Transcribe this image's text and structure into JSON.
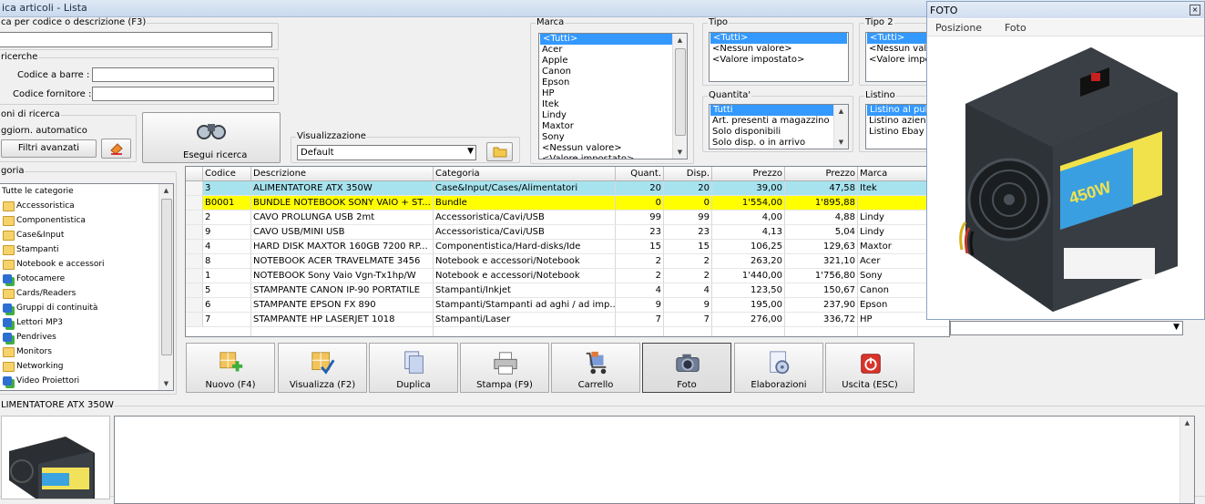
{
  "window": {
    "title": "ica articoli  - Lista"
  },
  "search": {
    "legend": "ca per codice o descrizione (F3)",
    "value": ""
  },
  "ricerche": {
    "legend": "ricerche",
    "barcode_label": "Codice a barre :",
    "supplier_label": "Codice fornitore :"
  },
  "opzioni": {
    "legend": "oni di ricerca",
    "auto_label": "ggiorn. automatico",
    "filters_button": "Filtri avanzati"
  },
  "esegui": {
    "label": "Esegui ricerca"
  },
  "visualizzazione": {
    "legend": "Visualizzazione",
    "value": "Default"
  },
  "marca": {
    "legend": "Marca",
    "items": [
      "<Tutti>",
      "Acer",
      "Apple",
      "Canon",
      "Epson",
      "HP",
      "Itek",
      "Lindy",
      "Maxtor",
      "Sony",
      "<Nessun valore>",
      "<Valore impostato>"
    ],
    "selected": "<Tutti>"
  },
  "tipo": {
    "legend": "Tipo",
    "items": [
      "<Tutti>",
      "<Nessun valore>",
      "<Valore impostato>"
    ],
    "selected": "<Tutti>"
  },
  "tipo2": {
    "legend": "Tipo 2",
    "items": [
      "<Tutti>",
      "<Nessun valor",
      "<Valore impost"
    ],
    "selected": "<Tutti>"
  },
  "quantita": {
    "legend": "Quantita'",
    "items": [
      "Tutti",
      "Art. presenti a magazzino",
      "Solo disponibili",
      "Solo disp. o in arrivo"
    ],
    "selected": "Tutti"
  },
  "listino": {
    "legend": "Listino",
    "items": [
      "Listino al pubb",
      "Listino aziende",
      "Listino Ebay"
    ],
    "selected": "Listino al pubb"
  },
  "categorie": {
    "legend": "goria",
    "items": [
      {
        "label": "Tutte le categorie",
        "icon": "none"
      },
      {
        "label": "Accessoristica",
        "icon": "folder-icon"
      },
      {
        "label": "Componentistica",
        "icon": "folder-icon"
      },
      {
        "label": "Case&Input",
        "icon": "folder-icon"
      },
      {
        "label": "Stampanti",
        "icon": "folder-icon"
      },
      {
        "label": "Notebook e accessori",
        "icon": "folder-icon"
      },
      {
        "label": "Fotocamere",
        "icon": "network-icon"
      },
      {
        "label": "Cards/Readers",
        "icon": "folder-icon"
      },
      {
        "label": "Gruppi di continuità",
        "icon": "network-icon"
      },
      {
        "label": "Lettori MP3",
        "icon": "network-icon"
      },
      {
        "label": "Pendrives",
        "icon": "network-icon"
      },
      {
        "label": "Monitors",
        "icon": "folder-icon"
      },
      {
        "label": "Networking",
        "icon": "folder-icon"
      },
      {
        "label": "Video Proiettori",
        "icon": "network-icon"
      }
    ]
  },
  "table": {
    "columns": [
      "Codice",
      "Descrizione",
      "Categoria",
      "Quant.",
      "Disp.",
      "Prezzo",
      "Prezzo",
      "Marca"
    ],
    "rows": [
      {
        "codice": "3",
        "descrizione": "ALIMENTATORE ATX 350W",
        "categoria": "Case&Input/Cases/Alimentatori",
        "quant": "20",
        "disp": "20",
        "prezzo1": "39,00",
        "prezzo2": "47,58",
        "marca": "Itek",
        "highlight": "#a6e3ef"
      },
      {
        "codice": "B0001",
        "descrizione": "BUNDLE NOTEBOOK SONY VAIO + ST...",
        "categoria": "Bundle",
        "quant": "0",
        "disp": "0",
        "prezzo1": "1'554,00",
        "prezzo2": "1'895,88",
        "marca": "",
        "highlight": "#ffff00"
      },
      {
        "codice": "2",
        "descrizione": "CAVO PROLUNGA USB 2mt",
        "categoria": "Accessoristica/Cavi/USB",
        "quant": "99",
        "disp": "99",
        "prezzo1": "4,00",
        "prezzo2": "4,88",
        "marca": "Lindy",
        "highlight": ""
      },
      {
        "codice": "9",
        "descrizione": "CAVO USB/MINI USB",
        "categoria": "Accessoristica/Cavi/USB",
        "quant": "23",
        "disp": "23",
        "prezzo1": "4,13",
        "prezzo2": "5,04",
        "marca": "Lindy",
        "highlight": ""
      },
      {
        "codice": "4",
        "descrizione": "HARD DISK MAXTOR 160GB 7200 RP...",
        "categoria": "Componentistica/Hard-disks/Ide",
        "quant": "15",
        "disp": "15",
        "prezzo1": "106,25",
        "prezzo2": "129,63",
        "marca": "Maxtor",
        "highlight": ""
      },
      {
        "codice": "8",
        "descrizione": "NOTEBOOK ACER TRAVELMATE 3456",
        "categoria": "Notebook e accessori/Notebook",
        "quant": "2",
        "disp": "2",
        "prezzo1": "263,20",
        "prezzo2": "321,10",
        "marca": "Acer",
        "highlight": ""
      },
      {
        "codice": "1",
        "descrizione": "NOTEBOOK Sony Vaio Vgn-Tx1hp/W",
        "categoria": "Notebook e accessori/Notebook",
        "quant": "2",
        "disp": "2",
        "prezzo1": "1'440,00",
        "prezzo2": "1'756,80",
        "marca": "Sony",
        "highlight": ""
      },
      {
        "codice": "5",
        "descrizione": "STAMPANTE CANON IP-90 PORTATILE",
        "categoria": "Stampanti/Inkjet",
        "quant": "4",
        "disp": "4",
        "prezzo1": "123,50",
        "prezzo2": "150,67",
        "marca": "Canon",
        "highlight": ""
      },
      {
        "codice": "6",
        "descrizione": "STAMPANTE EPSON FX 890",
        "categoria": "Stampanti/Stampanti ad aghi / ad imp...",
        "quant": "9",
        "disp": "9",
        "prezzo1": "195,00",
        "prezzo2": "237,90",
        "marca": "Epson",
        "highlight": ""
      },
      {
        "codice": "7",
        "descrizione": "STAMPANTE HP LASERJET 1018",
        "categoria": "Stampanti/Laser",
        "quant": "7",
        "disp": "7",
        "prezzo1": "276,00",
        "prezzo2": "336,72",
        "marca": "HP",
        "highlight": ""
      }
    ]
  },
  "toolbar": [
    {
      "label": "Nuovo (F4)",
      "icon": "new-icon"
    },
    {
      "label": "Visualizza (F2)",
      "icon": "view-icon"
    },
    {
      "label": "Duplica",
      "icon": "duplicate-icon"
    },
    {
      "label": "Stampa (F9)",
      "icon": "printer-icon"
    },
    {
      "label": "Carrello",
      "icon": "cart-icon"
    },
    {
      "label": "Foto",
      "icon": "camera-icon"
    },
    {
      "label": "Elaborazioni",
      "icon": "processing-icon"
    },
    {
      "label": "Uscita (ESC)",
      "icon": "exit-icon"
    }
  ],
  "detail": {
    "legend": "LIMENTATORE ATX 350W"
  },
  "foto_window": {
    "title": "FOTO",
    "menu": [
      "Posizione",
      "Foto"
    ],
    "product_text": "450W"
  }
}
